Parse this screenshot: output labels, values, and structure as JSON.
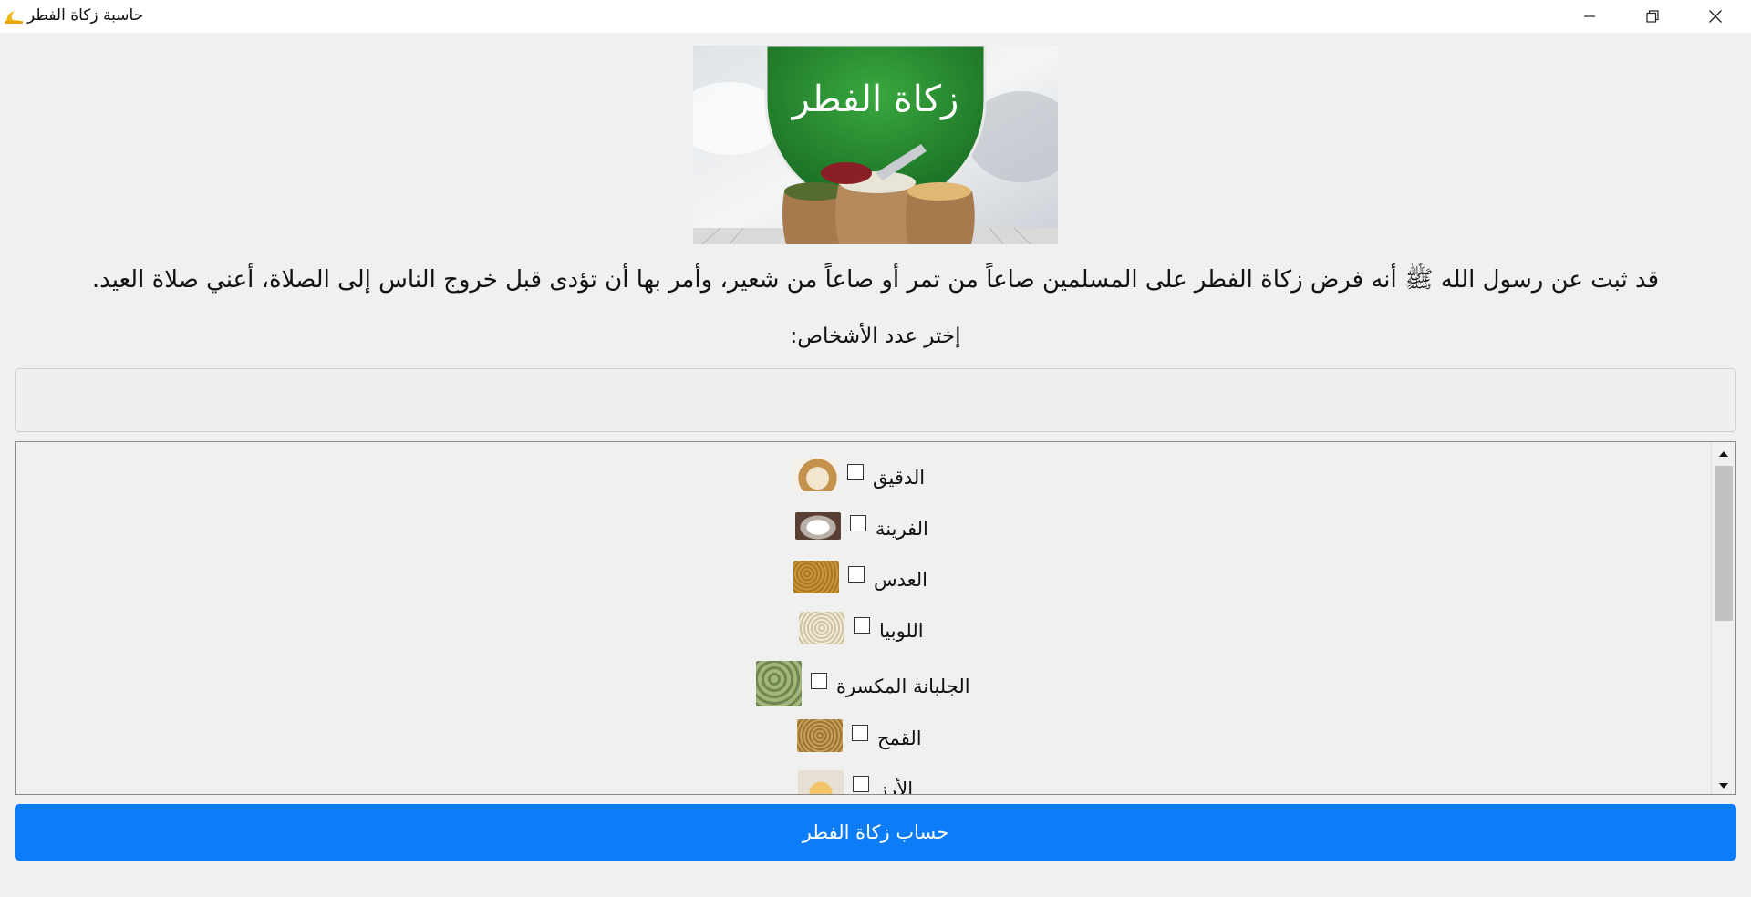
{
  "window": {
    "title": "حاسبة زكاة الفطر",
    "icon": "crescent-moon-icon",
    "controls": [
      "minimize-icon",
      "restore-icon",
      "close-icon"
    ]
  },
  "banner": {
    "title_art": "زكاة الفطر",
    "colors": {
      "emblem_green": "#1f8a2e",
      "sack": "#a77a4e",
      "sky": "#e6e9ec"
    }
  },
  "intro": {
    "hadith": "قد ثبت عن رسول الله ﷺ أنه فرض زكاة الفطر على المسلمين صاعاً من تمر أو صاعاً من شعير، وأمر بها أن تؤدى قبل خروج الناس إلى الصلاة، أعني صلاة العيد."
  },
  "persons": {
    "label": "إختر عدد الأشخاص:",
    "value": "",
    "placeholder": ""
  },
  "grains": {
    "items": [
      {
        "label": "الدقيق",
        "checked": false,
        "thumb": "flour-sack-image"
      },
      {
        "label": "الفرينة",
        "checked": false,
        "thumb": "white-flour-image"
      },
      {
        "label": "العدس",
        "checked": false,
        "thumb": "lentils-image"
      },
      {
        "label": "اللوبيا",
        "checked": false,
        "thumb": "beans-image"
      },
      {
        "label": "الجلبانة المكسرة",
        "checked": false,
        "thumb": "split-peas-image"
      },
      {
        "label": "القمح",
        "checked": false,
        "thumb": "wheat-image"
      },
      {
        "label": "الأرز",
        "checked": false,
        "thumb": "rice-image"
      }
    ]
  },
  "actions": {
    "calculate_label": "حساب زكاة الفطر",
    "accent": "#0d7df7"
  }
}
